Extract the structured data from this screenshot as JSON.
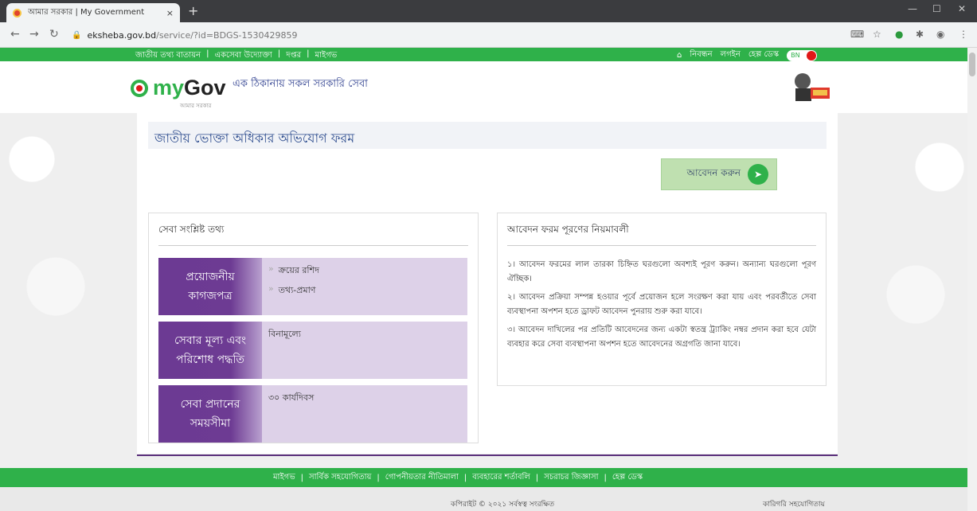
{
  "browser": {
    "tab_title": "আমার সরকার | My Government",
    "tab_close": "×",
    "new_tab": "+",
    "url_host": "eksheba.gov.bd",
    "url_path": "/service/?id=BDGS-1530429859",
    "icons": [
      "back-icon",
      "forward-icon",
      "reload-icon",
      "lock-icon",
      "translate-icon",
      "star-icon",
      "extension-icon",
      "puzzle-icon",
      "profile-icon",
      "menu-icon"
    ]
  },
  "top_nav": {
    "left_items": [
      "জাতীয় তথ্য বাতায়ন",
      "একসেবা উদ্যোক্তা",
      "দপ্তর",
      "মাইগভ"
    ],
    "separator": "|",
    "right_items": [
      "নিবন্ধন",
      "লগইন",
      "হেল্প ডেস্ক"
    ],
    "lang": "BN"
  },
  "header": {
    "logo_my": "my",
    "logo_gov": "Gov",
    "logo_sub": "আমার সরকার",
    "tagline": "এক ঠিকানায় সকল সরকারি সেবা"
  },
  "main": {
    "form_title": "জাতীয় ভোক্তা অধিকার অভিযোগ ফরম",
    "apply_label": "আবেদন করুন",
    "info_panel": {
      "title": "সেবা সংশ্লিষ্ট তথ্য",
      "rows": [
        {
          "label": "প্রয়োজনীয় কাগজপত্র",
          "values": [
            "ক্রয়ের রশিদ",
            "তথ্য-প্রমাণ"
          ]
        },
        {
          "label": "সেবার মূল্য এবং পরিশোধ পদ্ধতি",
          "values": [
            "বিনামূল্যে"
          ]
        },
        {
          "label": "সেবা প্রদানের সময়সীমা",
          "values": [
            "৩০ কার্যদিবস"
          ]
        }
      ]
    },
    "rules_panel": {
      "title": "আবেদন ফরম পূরণের নিয়মাবলী",
      "rules": [
        "১। আবেদন ফরমের লাল তারকা চিহ্নিত ঘরগুলো অবশ্যই পূরণ করুন। অন্যান্য ঘরগুলো পূরণ ঐচ্ছিক।",
        "২। আবেদন প্রক্রিয়া সম্পন্ন হওয়ার পূর্বে প্রয়োজন হলে সংরক্ষণ করা যায় এবং পরবর্তীতে সেবা ব্যবস্থাপনা অপশন হতে ড্রাফট আবেদন পুনরায় শুরু করা যাবে।",
        "৩। আবেদন দাখিলের পর প্রতিটি আবেদনের জন্য একটা স্বতন্ত্র ট্র্যাকিং নম্বর প্রদান করা হবে যেটা ব্যবহার করে সেবা ব্যবস্থাপনা অপশন হতে আবেদনের অগ্রগতি জানা যাবে।"
      ]
    }
  },
  "footer": {
    "nav": [
      "মাইগভ",
      "সার্বিক সহযোগিতায়",
      "গোপনীয়তার নীতিমালা",
      "ব্যবহারের শর্তাবলি",
      "সচরাচর জিজ্ঞাসা",
      "হেল্প ডেস্ক"
    ],
    "copyright": "কপিরাইট © ২০২১ সর্বস্বত্ব সংরক্ষিত",
    "tech_support": "কারিগরি সহযোগিতায়"
  },
  "colors": {
    "brand_green": "#2fb14a",
    "purple": "#6c3a93",
    "apply_bg": "#bfe0b0",
    "title_blue": "#2e4d8f"
  }
}
